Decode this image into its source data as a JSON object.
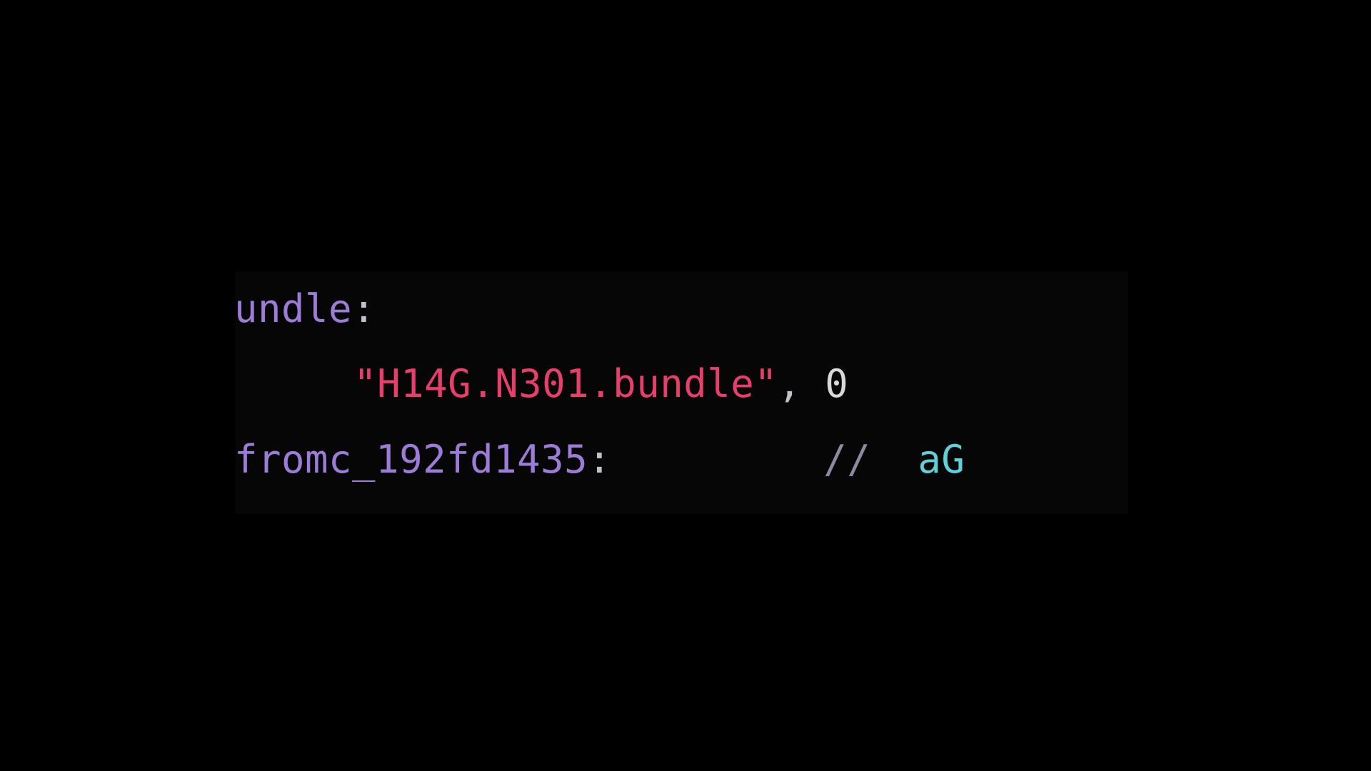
{
  "code": {
    "line1": {
      "label_fragment": "undle",
      "colon": ":"
    },
    "line2": {
      "indent": "     ",
      "string": "\"H14G.N301.bundle\"",
      "comma": ",",
      "space": " ",
      "number": "0"
    },
    "line3": {
      "label": "fromc_192fd1435",
      "colon": ":",
      "gap": "         ",
      "comment_slashes": "//",
      "comment_space": "  ",
      "comment_text": "aG"
    }
  }
}
